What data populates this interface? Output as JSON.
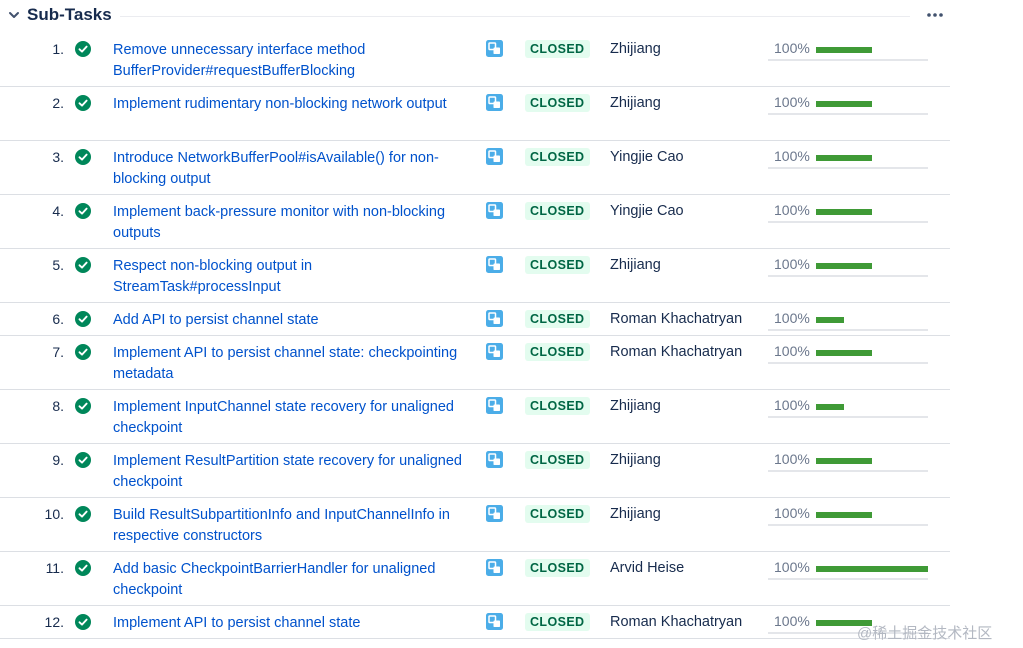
{
  "section": {
    "title": "Sub-Tasks"
  },
  "colors": {
    "link": "#0052cc",
    "closed_bg": "#e3fcef",
    "closed_text": "#006644",
    "progress": "#3f9a36",
    "done_icon": "#00875a",
    "subtask_icon": "#4bade8"
  },
  "tasks": [
    {
      "num": "1.",
      "summary": "Remove unnecessary interface method BufferProvider#requestBufferBlocking",
      "status": "CLOSED",
      "assignee": "Zhijiang",
      "progress_label": "100%",
      "progress": 1.0,
      "bar_width": 56
    },
    {
      "num": "2.",
      "summary": "Implement rudimentary non-blocking network output",
      "status": "CLOSED",
      "assignee": "Zhijiang",
      "progress_label": "100%",
      "progress": 1.0,
      "bar_width": 56
    },
    {
      "num": "3.",
      "summary": "Introduce NetworkBufferPool#isAvailable() for non-blocking output",
      "status": "CLOSED",
      "assignee": "Yingjie Cao",
      "progress_label": "100%",
      "progress": 1.0,
      "bar_width": 56
    },
    {
      "num": "4.",
      "summary": "Implement back-pressure monitor with non-blocking outputs",
      "status": "CLOSED",
      "assignee": "Yingjie Cao",
      "progress_label": "100%",
      "progress": 1.0,
      "bar_width": 56
    },
    {
      "num": "5.",
      "summary": "Respect non-blocking output in StreamTask#processInput",
      "status": "CLOSED",
      "assignee": "Zhijiang",
      "progress_label": "100%",
      "progress": 1.0,
      "bar_width": 56
    },
    {
      "num": "6.",
      "summary": "Add API to persist channel state",
      "status": "CLOSED",
      "assignee": "Roman Khachatryan",
      "progress_label": "100%",
      "progress": 1.0,
      "bar_width": 28
    },
    {
      "num": "7.",
      "summary": "Implement API to persist channel state: checkpointing metadata",
      "status": "CLOSED",
      "assignee": "Roman Khachatryan",
      "progress_label": "100%",
      "progress": 1.0,
      "bar_width": 56
    },
    {
      "num": "8.",
      "summary": "Implement InputChannel state recovery for unaligned checkpoint",
      "status": "CLOSED",
      "assignee": "Zhijiang",
      "progress_label": "100%",
      "progress": 1.0,
      "bar_width": 28
    },
    {
      "num": "9.",
      "summary": "Implement ResultPartition state recovery for unaligned checkpoint",
      "status": "CLOSED",
      "assignee": "Zhijiang",
      "progress_label": "100%",
      "progress": 1.0,
      "bar_width": 56
    },
    {
      "num": "10.",
      "summary": "Build ResultSubpartitionInfo and InputChannelInfo in respective constructors",
      "status": "CLOSED",
      "assignee": "Zhijiang",
      "progress_label": "100%",
      "progress": 1.0,
      "bar_width": 56
    },
    {
      "num": "11.",
      "summary": "Add basic CheckpointBarrierHandler for unaligned checkpoint",
      "status": "CLOSED",
      "assignee": "Arvid Heise",
      "progress_label": "100%",
      "progress": 1.0,
      "bar_width": 112
    },
    {
      "num": "12.",
      "summary": "Implement API to persist channel state",
      "status": "CLOSED",
      "assignee": "Roman Khachatryan",
      "progress_label": "100%",
      "progress": 1.0,
      "bar_width": 56
    }
  ],
  "watermark": "@稀土掘金技术社区"
}
